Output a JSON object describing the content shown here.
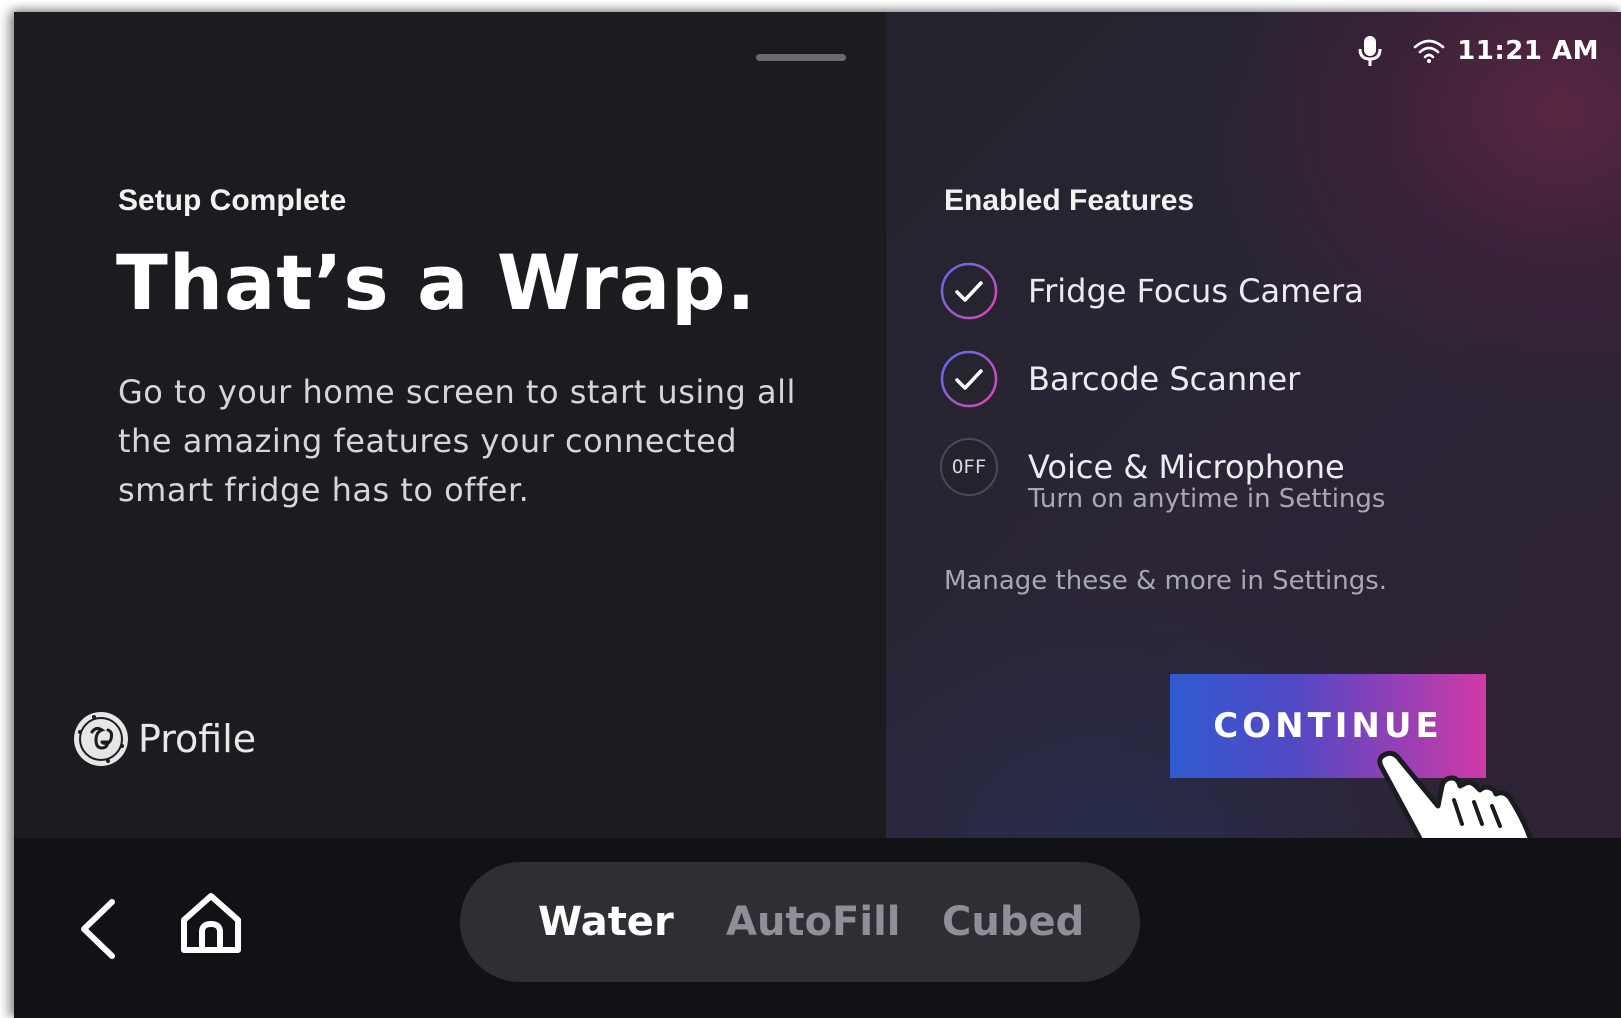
{
  "status_bar": {
    "time": "11:21 AM",
    "icons": [
      "microphone-icon",
      "wifi-icon"
    ]
  },
  "left": {
    "setup_label": "Setup Complete",
    "title": "That’s a Wrap.",
    "description": "Go to your home screen to start using all the amazing features your connected smart fridge has to offer.",
    "brand_name": "Profile",
    "brand_logo": "ge-logo-icon"
  },
  "right": {
    "heading": "Enabled Features",
    "features": [
      {
        "name": "Fridge Focus Camera",
        "state": "enabled",
        "icon": "check-icon",
        "sub": ""
      },
      {
        "name": "Barcode Scanner",
        "state": "enabled",
        "icon": "check-icon",
        "sub": ""
      },
      {
        "name": "Voice & Microphone",
        "state": "off",
        "badge_text": "OFF",
        "sub": "Turn on anytime in Settings"
      }
    ],
    "manage_note": "Manage these & more in Settings.",
    "continue_label": "CONTINUE"
  },
  "bottom_bar": {
    "modes": [
      "Water",
      "AutoFill",
      "Cubed"
    ],
    "active_mode": "Water",
    "icons": [
      "back-chevron-icon",
      "home-icon"
    ]
  },
  "colors": {
    "background": "#1b1c20",
    "accent_blue": "#2f5bd0",
    "accent_pink": "#d13aa6",
    "check_ring_start": "#5a6cf0",
    "check_ring_end": "#e046b6"
  }
}
